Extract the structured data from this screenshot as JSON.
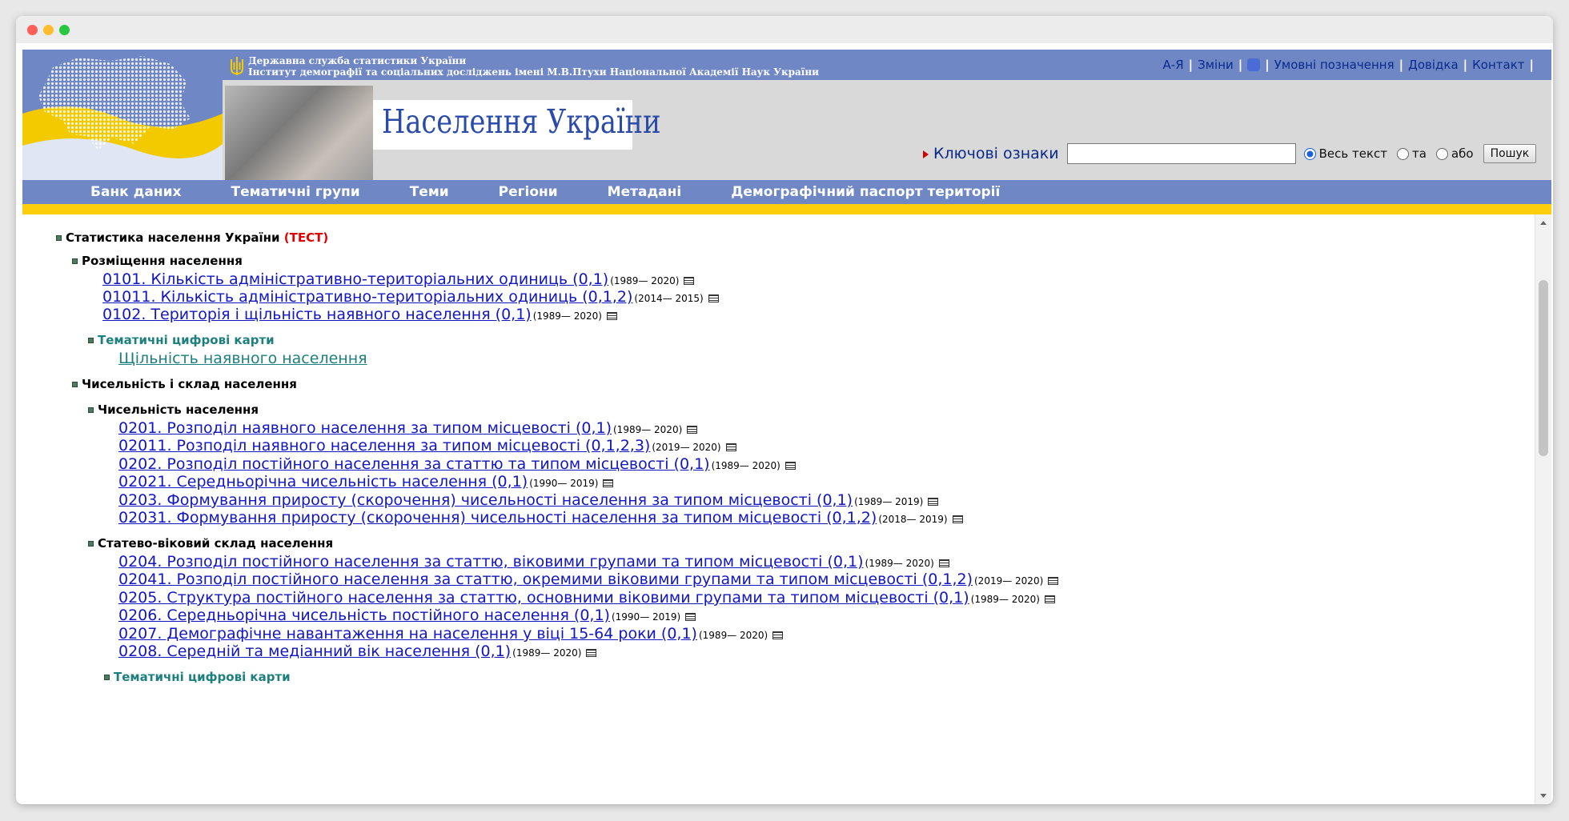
{
  "header": {
    "org_line1": "Державна служба статистики України",
    "org_line2": "Інститут демографії та соціальних досліджень імені М.В.Птухи Національної Академії Наук України",
    "brand": "Населення України",
    "toplinks": [
      "А-Я",
      "Зміни",
      "Умовні позначення",
      "Довідка",
      "Контакт"
    ],
    "search": {
      "label": "Ключові ознаки",
      "value": "",
      "options": [
        "Весь текст",
        "та",
        "або"
      ],
      "selected": "Весь текст",
      "button": "Пошук"
    }
  },
  "nav": [
    "Банк даних",
    "Тематичні групи",
    "Теми",
    "Регіони",
    "Метадані",
    "Демографічний паспорт території"
  ],
  "tree": {
    "root_title": "Статистика населення України",
    "root_tag": "(ТЕСТ)",
    "s1_title": "Розміщення населення",
    "s1_items": [
      {
        "text": "0101. Кількість адміністративно-територіальних одиниць (0,1)",
        "years": "(1989— 2020)"
      },
      {
        "text": "01011. Кількість адміністративно-територіальних одиниць (0,1,2)",
        "years": "(2014— 2015)"
      },
      {
        "text": "0102. Територія і щільність наявного населення (0,1)",
        "years": "(1989— 2020)"
      }
    ],
    "s1_maps_title": "Тематичні цифрові карти",
    "s1_map_link": "Щільність наявного населення",
    "s2_title": "Чисельність і склад населення",
    "s2a_title": "Чисельність населення",
    "s2a_items": [
      {
        "text": "0201. Розподіл наявного населення за типом місцевості (0,1)",
        "years": "(1989— 2020)"
      },
      {
        "text": "02011. Розподіл наявного населення за типом місцевості (0,1,2,3)",
        "years": "(2019— 2020)"
      },
      {
        "text": "0202. Розподіл постійного населення за статтю та типом місцевості (0,1)",
        "years": "(1989— 2020)"
      },
      {
        "text": "02021. Середньорічна чисельність населення (0,1)",
        "years": "(1990— 2019)"
      },
      {
        "text": "0203. Формування приросту (скорочення) чисельності населення за типом місцевості (0,1)",
        "years": "(1989— 2019)"
      },
      {
        "text": "02031. Формування приросту (скорочення) чисельності населення за типом місцевості (0,1,2)",
        "years": "(2018— 2019)"
      }
    ],
    "s2b_title": "Статево-віковий склад населення",
    "s2b_items": [
      {
        "text": "0204. Розподіл постійного населення за статтю, віковими групами та типом місцевості (0,1)",
        "years": "(1989— 2020)"
      },
      {
        "text": "02041. Розподіл постійного населення за статтю, окремими віковими групами та типом місцевості (0,1,2)",
        "years": "(2019— 2020)"
      },
      {
        "text": "0205. Структура постійного населення за статтю, основними віковими групами та типом місцевості (0,1)",
        "years": "(1989— 2020)"
      },
      {
        "text": "0206. Середньорічна чисельність постійного населення (0,1)",
        "years": "(1990— 2019)"
      },
      {
        "text": "0207. Демографічне навантаження на населення у віці 15-64 роки (0,1)",
        "years": "(1989— 2020)"
      },
      {
        "text": "0208. Середній та медіанний вік населення (0,1)",
        "years": "(1989— 2020)"
      }
    ],
    "s2b_maps_title": "Тематичні цифрові карти"
  },
  "colors": {
    "nav_bg": "#6f87c4",
    "stripe": "#fdce0c",
    "link": "#1216c0",
    "teal": "#1e7f7f",
    "test_red": "#e00000"
  }
}
